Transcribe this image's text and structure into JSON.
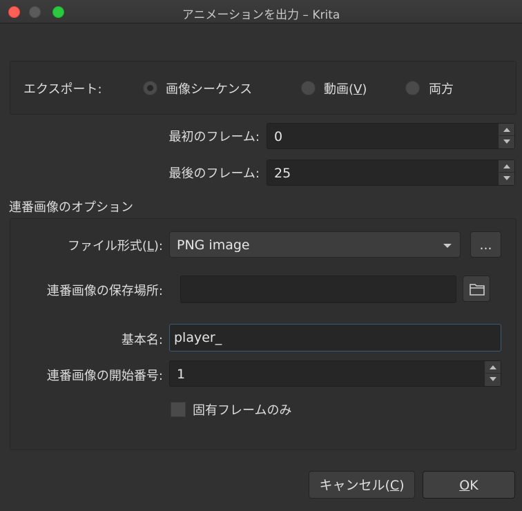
{
  "window": {
    "title": "アニメーションを出力 – Krita"
  },
  "export": {
    "label": "エクスポート:",
    "options": [
      {
        "label": "画像シーケンス",
        "checked": true
      },
      {
        "label_pre": "動画(",
        "mnemonic": "V",
        "label_post": ")",
        "checked": false
      },
      {
        "label": "両方",
        "checked": false
      }
    ]
  },
  "frames": {
    "first_label": "最初のフレーム:",
    "first_value": "0",
    "last_label": "最後のフレーム:",
    "last_value": "25"
  },
  "sequence": {
    "section_title": "連番画像のオプション",
    "file_format_label_pre": "ファイル形式(",
    "file_format_mnemonic": "L",
    "file_format_label_post": "):",
    "file_format_value": "PNG image",
    "options_button": "...",
    "location_label": "連番画像の保存場所:",
    "location_value": "",
    "basename_label": "基本名:",
    "basename_value": "player_",
    "start_label": "連番画像の開始番号:",
    "start_value": "1",
    "unique_frames_label": "固有フレームのみ",
    "unique_frames_checked": false
  },
  "buttons": {
    "cancel_pre": "キャンセル(",
    "cancel_mnemonic": "C",
    "cancel_post": ")",
    "ok_mnemonic": "O",
    "ok_rest": "K"
  },
  "colors": {
    "background": "#313131",
    "field": "#262626",
    "focus_border": "#3c5a7a"
  }
}
